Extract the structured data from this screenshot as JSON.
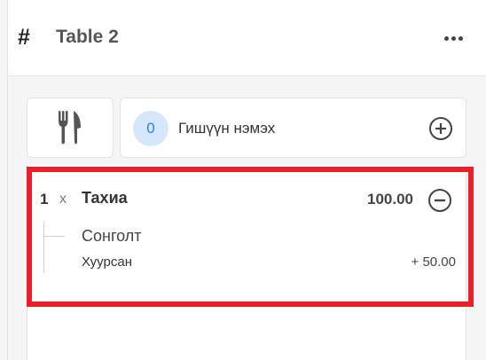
{
  "header": {
    "hash": "#",
    "title": "Table 2",
    "more_icon": "more-horizontal-icon"
  },
  "actions": {
    "cutlery_icon": "fork-knife-icon",
    "guest_count": "0",
    "guest_label": "Гишүүн нэмэх",
    "add_icon": "plus-circle-icon"
  },
  "order": {
    "items": [
      {
        "qty": "1",
        "times": "x",
        "name": "Тахиа",
        "price": "100.00",
        "remove_icon": "minus-circle-icon",
        "option_group": "Сонголт",
        "options": [
          {
            "name": "Хуурсан",
            "price": "+ 50.00"
          }
        ]
      }
    ]
  },
  "colors": {
    "highlight": "#e8202a",
    "guest_badge_bg": "#d6e6fb",
    "guest_badge_text": "#2f80ed"
  }
}
